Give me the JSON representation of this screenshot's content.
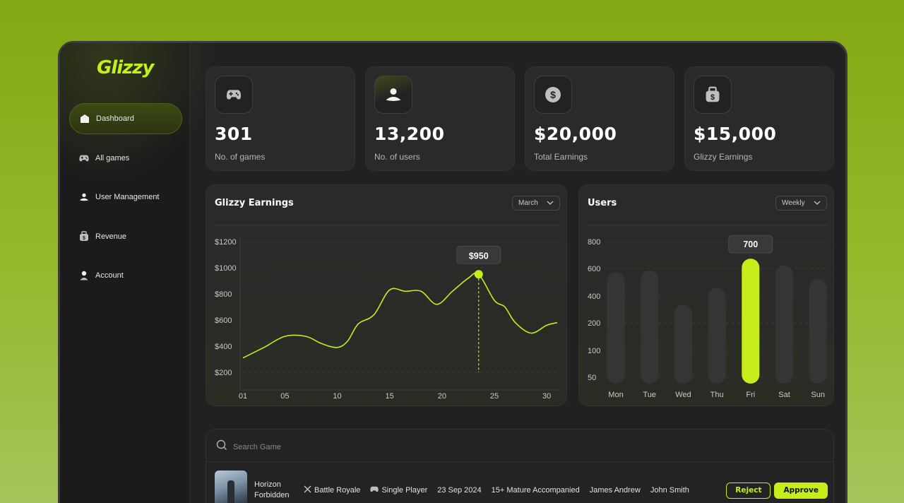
{
  "brand": {
    "logo": "Glizzy",
    "accent": "#c6ee1a"
  },
  "sidebar": {
    "items": [
      {
        "label": "Dashboard",
        "icon": "home-icon",
        "active": true
      },
      {
        "label": "All games",
        "icon": "gamepad-icon"
      },
      {
        "label": "User Management",
        "icon": "users-icon"
      },
      {
        "label": "Revenue",
        "icon": "money-bag-icon"
      },
      {
        "label": "Account",
        "icon": "user-icon"
      }
    ]
  },
  "stats": [
    {
      "value": "301",
      "label": "No. of games",
      "icon": "gamepad-icon"
    },
    {
      "value": "13,200",
      "label": "No. of users",
      "icon": "users-icon"
    },
    {
      "value": "$20,000",
      "label": "Total Earnings",
      "icon": "dollar-icon"
    },
    {
      "value": "$15,000",
      "label": "Glizzy Earnings",
      "icon": "money-bag-icon"
    }
  ],
  "earnings_panel": {
    "title": "Glizzy Earnings",
    "dropdown": "March"
  },
  "users_panel": {
    "title": "Users",
    "dropdown": "Weekly"
  },
  "chart_data": [
    {
      "type": "line",
      "title": "Glizzy Earnings",
      "x_ticks": [
        "01",
        "05",
        "10",
        "15",
        "20",
        "25",
        "30"
      ],
      "y_ticks": [
        "$1200",
        "$1000",
        "$800",
        "$600",
        "$400",
        "$200"
      ],
      "ylim": [
        200,
        1200
      ],
      "xlim": [
        1,
        31
      ],
      "x": [
        1,
        3,
        5,
        7,
        8.5,
        10,
        11,
        12,
        13.5,
        15,
        16.5,
        18,
        19.5,
        21,
        22.5,
        23.5,
        25,
        26,
        27,
        28.5,
        30,
        31
      ],
      "y": [
        310,
        390,
        475,
        475,
        420,
        390,
        440,
        570,
        640,
        830,
        820,
        820,
        720,
        820,
        920,
        950,
        750,
        700,
        580,
        500,
        560,
        580
      ],
      "highlight": {
        "x": 23.5,
        "y": 950,
        "label": "$950"
      },
      "grid": true,
      "color": "#c6ee1a"
    },
    {
      "type": "bar",
      "title": "Users",
      "categories": [
        "Mon",
        "Tue",
        "Wed",
        "Thu",
        "Fri",
        "Sat",
        "Sun"
      ],
      "values": [
        620,
        630,
        430,
        530,
        700,
        660,
        580
      ],
      "y_ticks": [
        "800",
        "600",
        "400",
        "200",
        "100",
        "50"
      ],
      "highlight": {
        "category": "Fri",
        "label": "700"
      },
      "color": "#c6ee1a"
    }
  ],
  "search": {
    "placeholder": "Search Game"
  },
  "games": [
    {
      "name": "Horizon Forbidden",
      "genre": "Battle Royale",
      "mode": "Single Player",
      "date": "23 Sep 2024",
      "rating": "15+ Mature Accompanied",
      "developer": "James Andrew",
      "publisher": "John Smith",
      "reject_label": "Reject",
      "approve_label": "Approve"
    }
  ]
}
